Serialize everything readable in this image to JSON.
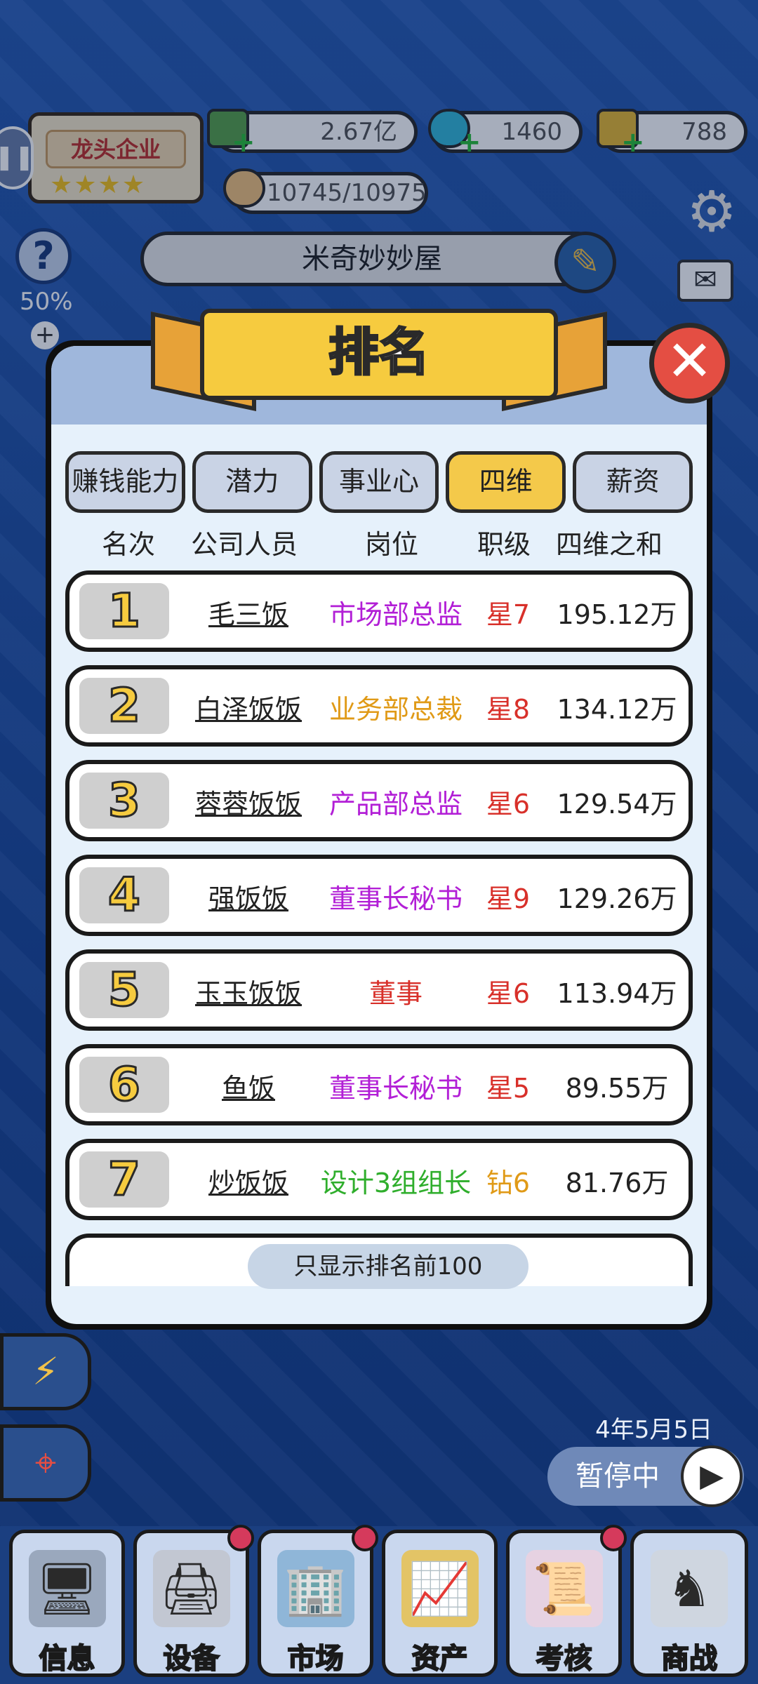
{
  "hud": {
    "badge_label": "龙头企业",
    "badge_stars": "★★★★",
    "money": "2.67亿",
    "diamonds": "1460",
    "gold": "788",
    "likes": "10745/10975",
    "help_percent": "50%",
    "company_name": "米奇妙妙屋"
  },
  "modal": {
    "title": "排名",
    "tabs": [
      {
        "label": "赚钱能力",
        "active": false
      },
      {
        "label": "潜力",
        "active": false
      },
      {
        "label": "事业心",
        "active": false
      },
      {
        "label": "四维",
        "active": true
      },
      {
        "label": "薪资",
        "active": false
      }
    ],
    "columns": [
      "名次",
      "公司人员",
      "岗位",
      "职级",
      "四维之和"
    ],
    "rows": [
      {
        "rank": "1",
        "name": "毛三饭",
        "position": "市场部总监",
        "position_color": "#b21fd6",
        "level": "星7",
        "level_color": "#d8302a",
        "total": "195.12万"
      },
      {
        "rank": "2",
        "name": "白泽饭饭",
        "position": "业务部总裁",
        "position_color": "#e09a17",
        "level": "星8",
        "level_color": "#d8302a",
        "total": "134.12万"
      },
      {
        "rank": "3",
        "name": "蓉蓉饭饭",
        "position": "产品部总监",
        "position_color": "#b21fd6",
        "level": "星6",
        "level_color": "#d8302a",
        "total": "129.54万"
      },
      {
        "rank": "4",
        "name": "强饭饭",
        "position": "董事长秘书",
        "position_color": "#b21fd6",
        "level": "星9",
        "level_color": "#d8302a",
        "total": "129.26万"
      },
      {
        "rank": "5",
        "name": "玉玉饭饭",
        "position": "董事",
        "position_color": "#d8302a",
        "level": "星6",
        "level_color": "#d8302a",
        "total": "113.94万"
      },
      {
        "rank": "6",
        "name": "鱼饭",
        "position": "董事长秘书",
        "position_color": "#b21fd6",
        "level": "星5",
        "level_color": "#d8302a",
        "total": "89.55万"
      },
      {
        "rank": "7",
        "name": "炒饭饭",
        "position": "设计3组组长",
        "position_color": "#2fae2c",
        "level": "钻6",
        "level_color": "#e09a17",
        "total": "81.76万"
      }
    ],
    "footer_note": "只显示排名前100"
  },
  "status": {
    "date": "4年5月5日",
    "pause_label": "暂停中"
  },
  "nav": [
    {
      "label": "信息",
      "icon": "monitor-icon",
      "dot": false
    },
    {
      "label": "设备",
      "icon": "printer-icon",
      "dot": true
    },
    {
      "label": "市场",
      "icon": "building-icon",
      "dot": true
    },
    {
      "label": "资产",
      "icon": "chart-up-icon",
      "dot": false
    },
    {
      "label": "考核",
      "icon": "document-icon",
      "dot": true
    },
    {
      "label": "商战",
      "icon": "chess-icon",
      "dot": false
    }
  ]
}
